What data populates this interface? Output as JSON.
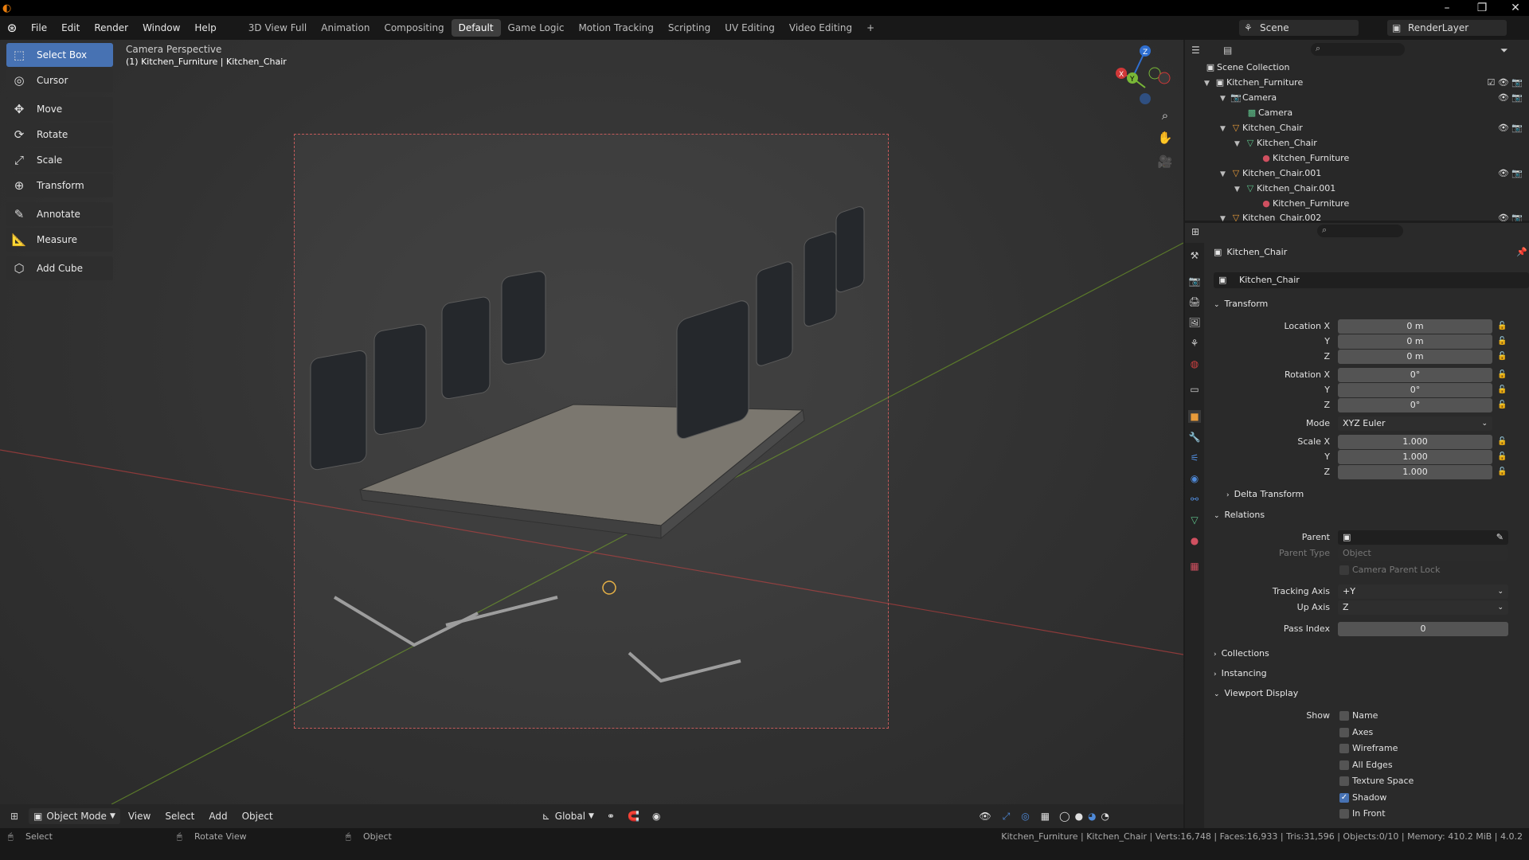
{
  "menubar": {
    "items": [
      "File",
      "Edit",
      "Render",
      "Window",
      "Help"
    ],
    "workspaces": [
      "3D View Full",
      "Animation",
      "Compositing",
      "Default",
      "Game Logic",
      "Motion Tracking",
      "Scripting",
      "UV Editing",
      "Video Editing",
      "+"
    ],
    "active_workspace": "Default",
    "scene": "Scene",
    "render_layer": "RenderLayer"
  },
  "tools": [
    "Select Box",
    "Cursor",
    "Move",
    "Rotate",
    "Scale",
    "Transform",
    "Annotate",
    "Measure",
    "Add Cube"
  ],
  "viewport": {
    "title": "Camera Perspective",
    "subtitle": "(1) Kitchen_Furniture | Kitchen_Chair",
    "gizmo_x": "X",
    "gizmo_y": "Y",
    "gizmo_z": "Z"
  },
  "header3d": {
    "mode": "Object Mode",
    "view": "View",
    "select": "Select",
    "add": "Add",
    "object": "Object",
    "orientation": "Global"
  },
  "statusbar": {
    "select": "Select",
    "rotate": "Rotate View",
    "object": "Object",
    "info": "Kitchen_Furniture | Kitchen_Chair | Verts:16,748 | Faces:16,933 | Tris:31,596 | Objects:0/10 | Memory: 410.2 MiB | 4.0.2"
  },
  "outliner": {
    "root": "Scene Collection",
    "rows": [
      "Kitchen_Furniture",
      "Camera",
      "Camera",
      "Kitchen_Chair",
      "Kitchen_Chair",
      "Kitchen_Furniture",
      "Kitchen_Chair.001",
      "Kitchen_Chair.001",
      "Kitchen_Furniture",
      "Kitchen_Chair.002"
    ]
  },
  "properties": {
    "object_name": "Kitchen_Chair",
    "data_name": "Kitchen_Chair",
    "transform": {
      "title": "Transform",
      "location_label": "Location X",
      "rotation_label": "Rotation X",
      "scale_label": "Scale X",
      "y": "Y",
      "z": "Z",
      "loc": [
        "0 m",
        "0 m",
        "0 m"
      ],
      "rot": [
        "0°",
        "0°",
        "0°"
      ],
      "mode_label": "Mode",
      "mode": "XYZ Euler",
      "scale": [
        "1.000",
        "1.000",
        "1.000"
      ],
      "delta": "Delta Transform"
    },
    "relations": {
      "title": "Relations",
      "parent": "Parent",
      "parent_type": "Parent Type",
      "parent_type_val": "Object",
      "camera_lock": "Camera Parent Lock",
      "tracking_axis": "Tracking Axis",
      "tracking_val": "+Y",
      "up_axis": "Up Axis",
      "up_val": "Z",
      "pass_index": "Pass Index",
      "pass_val": "0"
    },
    "collections": "Collections",
    "instancing": "Instancing",
    "viewport_display": {
      "title": "Viewport Display",
      "show": "Show",
      "options": [
        "Name",
        "Axes",
        "Wireframe",
        "All Edges",
        "Texture Space",
        "Shadow",
        "In Front"
      ],
      "checked": [
        false,
        false,
        false,
        false,
        false,
        true,
        false
      ]
    }
  }
}
